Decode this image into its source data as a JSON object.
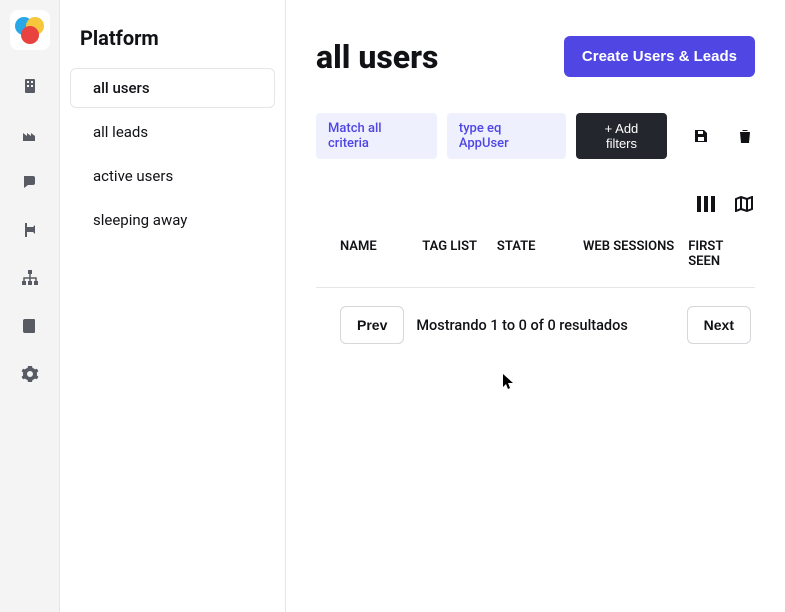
{
  "iconbar": {
    "items": [
      {
        "name": "building-icon"
      },
      {
        "name": "factory-icon"
      },
      {
        "name": "chat-icon"
      },
      {
        "name": "flag-icon"
      },
      {
        "name": "sitemap-icon"
      },
      {
        "name": "book-icon"
      },
      {
        "name": "gear-icon"
      }
    ]
  },
  "sidebar": {
    "title": "Platform",
    "segments": [
      {
        "label": "all users",
        "active": true
      },
      {
        "label": "all leads",
        "active": false
      },
      {
        "label": "active users",
        "active": false
      },
      {
        "label": "sleeping away",
        "active": false
      }
    ]
  },
  "page": {
    "title": "all users",
    "create_button": "Create Users & Leads"
  },
  "filters": {
    "match_label": "Match all criteria",
    "type_label": "type eq AppUser",
    "add_label": "+ Add filters"
  },
  "columns": {
    "name": "NAME",
    "tag": "TAG LIST",
    "state": "STATE",
    "web": "WEB SESSIONS",
    "first": "FIRST SEEN"
  },
  "pager": {
    "prev": "Prev",
    "next": "Next",
    "info": "Mostrando 1 to 0 of 0 resultados"
  }
}
